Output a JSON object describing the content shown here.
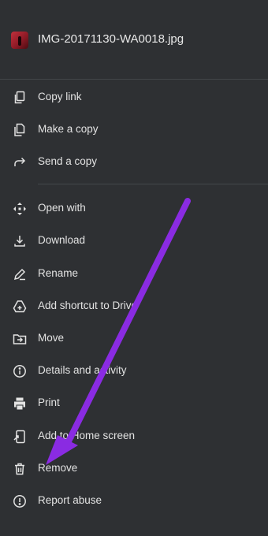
{
  "file": {
    "name": "IMG-20171130-WA0018.jpg",
    "thumbnail_icon": "image-thumbnail"
  },
  "menu": {
    "group1": [
      {
        "label": "Copy link",
        "icon": "copy-icon"
      },
      {
        "label": "Make a copy",
        "icon": "file-copy-icon"
      },
      {
        "label": "Send a copy",
        "icon": "share-arrow-icon"
      }
    ],
    "group2": [
      {
        "label": "Open with",
        "icon": "open-with-icon"
      },
      {
        "label": "Download",
        "icon": "download-icon"
      },
      {
        "label": "Rename",
        "icon": "pencil-icon"
      },
      {
        "label": "Add shortcut to Drive",
        "icon": "drive-shortcut-icon"
      },
      {
        "label": "Move",
        "icon": "folder-move-icon"
      },
      {
        "label": "Details and activity",
        "icon": "info-icon"
      },
      {
        "label": "Print",
        "icon": "print-icon"
      },
      {
        "label": "Add to Home screen",
        "icon": "add-to-home-icon"
      },
      {
        "label": "Remove",
        "icon": "trash-icon"
      },
      {
        "label": "Report abuse",
        "icon": "report-icon"
      }
    ]
  },
  "annotation": {
    "arrow_color": "#8a2be2",
    "arrow_target": "Remove"
  },
  "colors": {
    "background": "#2e3033",
    "text": "#e3e3e3",
    "divider": "#44474a"
  }
}
